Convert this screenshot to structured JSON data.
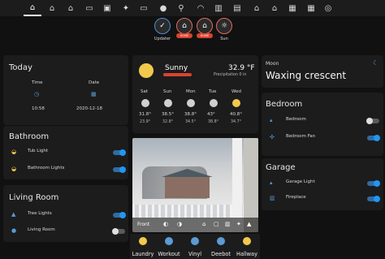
{
  "top_tabs": [
    {
      "name": "home-icon",
      "glyph": "⌂",
      "active": true
    },
    {
      "name": "house-icon-2",
      "glyph": "⌂",
      "active": false
    },
    {
      "name": "house-icon-3",
      "glyph": "⌂",
      "active": false
    },
    {
      "name": "bed-icon",
      "glyph": "▭",
      "active": false
    },
    {
      "name": "tv-icon",
      "glyph": "▣",
      "active": false
    },
    {
      "name": "figure-icon",
      "glyph": "✦",
      "active": false
    },
    {
      "name": "sofa-icon",
      "glyph": "▭",
      "active": false
    },
    {
      "name": "child-icon",
      "glyph": "●",
      "active": false
    },
    {
      "name": "person-icon",
      "glyph": "⚲",
      "active": false
    },
    {
      "name": "bath-icon",
      "glyph": "◠",
      "active": false
    },
    {
      "name": "garage-icon",
      "glyph": "▥",
      "active": false
    },
    {
      "name": "garage-icon-2",
      "glyph": "▤",
      "active": false
    },
    {
      "name": "home-icon-4",
      "glyph": "⌂",
      "active": false
    },
    {
      "name": "house-icon-5",
      "glyph": "⌂",
      "active": false
    },
    {
      "name": "calendar-icon",
      "glyph": "▦",
      "active": false
    },
    {
      "name": "grid-icon",
      "glyph": "▦",
      "active": false
    },
    {
      "name": "robot-icon",
      "glyph": "◎",
      "active": false
    }
  ],
  "badges": [
    {
      "label": "Updater",
      "style": "ok",
      "glyph": "✓"
    },
    {
      "label": "",
      "style": "red",
      "glyph": "⌂",
      "tag": "HOME"
    },
    {
      "label": "",
      "style": "red",
      "glyph": "⌂",
      "tag": "HOME"
    },
    {
      "label": "Sun",
      "style": "red",
      "glyph": "☼"
    }
  ],
  "today": {
    "title": "Today",
    "time_label": "Time",
    "date_label": "Date",
    "time": "10:58",
    "date": "2020-12-18"
  },
  "weather": {
    "condition": "Sunny",
    "temp": "32.9 °F",
    "precip": "Precipitation 0 in",
    "forecast": [
      {
        "day": "Sat",
        "hi": "31.8°",
        "lo": "23.9°",
        "icon": "snow"
      },
      {
        "day": "Sun",
        "hi": "38.5°",
        "lo": "32.8°",
        "icon": "snow"
      },
      {
        "day": "Mon",
        "hi": "38.8°",
        "lo": "34.5°",
        "icon": "snow"
      },
      {
        "day": "Tue",
        "hi": "43°",
        "lo": "38.8°",
        "icon": "snow"
      },
      {
        "day": "Wed",
        "hi": "40.8°",
        "lo": "34.7°",
        "icon": "sun"
      }
    ]
  },
  "moon": {
    "label": "Moon",
    "phase": "Waxing crescent"
  },
  "bathroom": {
    "title": "Bathroom",
    "items": [
      {
        "label": "Tub Light",
        "on": true
      },
      {
        "label": "Bathroom Lights",
        "on": true
      }
    ]
  },
  "living": {
    "title": "Living Room",
    "items": [
      {
        "label": "Tree Lights",
        "on": true
      },
      {
        "label": "Living Room",
        "on": false
      }
    ]
  },
  "bedroom": {
    "title": "Bedroom",
    "items": [
      {
        "label": "Bedroom",
        "on": false
      },
      {
        "label": "Bedroom Fan",
        "on": true
      }
    ]
  },
  "garage": {
    "title": "Garage",
    "items": [
      {
        "label": "Garage Light",
        "on": true
      },
      {
        "label": "Fireplace",
        "on": true
      }
    ]
  },
  "camera": {
    "label": "Front"
  },
  "bottom_nav": [
    {
      "label": "Laundry",
      "color": "#f2c94c"
    },
    {
      "label": "Workout",
      "color": "#5b9bd5"
    },
    {
      "label": "Vinyl",
      "color": "#5b9bd5"
    },
    {
      "label": "Deebot",
      "color": "#5b9bd5"
    },
    {
      "label": "Hallway",
      "color": "#f2c94c"
    }
  ]
}
